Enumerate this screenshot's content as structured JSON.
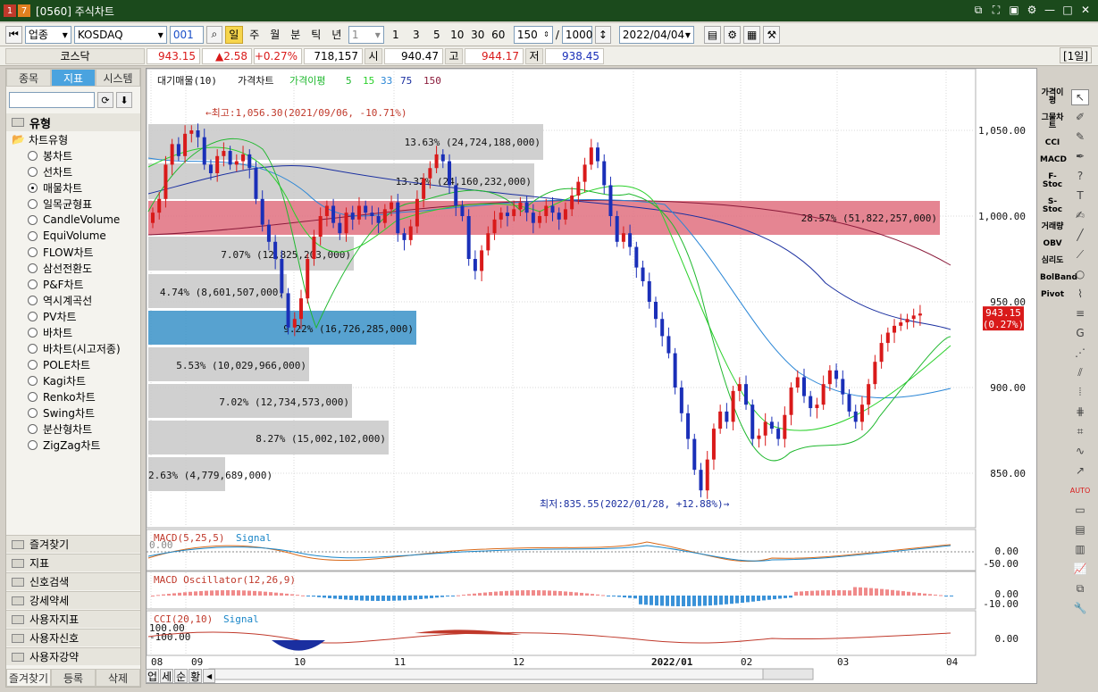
{
  "window": {
    "index_label": "1",
    "index_label2": "7",
    "title": "[0560] 주식차트",
    "controls": [
      "⧉",
      "⛶",
      "▣",
      "⚙",
      "—",
      "□",
      "✕"
    ]
  },
  "toolbar": {
    "market": "업종",
    "index_name": "KOSDAQ",
    "code": "001",
    "periods": [
      "일",
      "주",
      "월",
      "분",
      "틱",
      "년"
    ],
    "interval_value": "1",
    "interval_options": [
      "1",
      "3",
      "5",
      "10",
      "30",
      "60"
    ],
    "count": "150",
    "slash": "/",
    "total": "1000",
    "date": "2022/04/04"
  },
  "quote": {
    "name": "코스닥",
    "price": "943.15",
    "change": "▲2.58",
    "change_pct": "+0.27%",
    "volume": "718,157",
    "open_label": "시",
    "open": "940.47",
    "high_label": "고",
    "high": "944.17",
    "low_label": "저",
    "low": "938.45",
    "period_badge": "[1일]"
  },
  "left_panel": {
    "tabs": [
      "종목",
      "지표",
      "시스템"
    ],
    "active_tab": "지표",
    "section_title": "유형",
    "subsection": "차트유형",
    "chart_types": [
      "봉차트",
      "선차트",
      "매물차트",
      "일목균형표",
      "CandleVolume",
      "EquiVolume",
      "FLOW차트",
      "삼선전환도",
      "P&F차트",
      "역시계곡선",
      "PV차트",
      "바차트",
      "바차트(시고저종)",
      "POLE차트",
      "Kagi차트",
      "Renko차트",
      "Swing차트",
      "분산형차트",
      "ZigZag차트"
    ],
    "selected_type": "매물차트",
    "groups": [
      "즐겨찾기",
      "지표",
      "신호검색",
      "강세약세",
      "사용자지표",
      "사용자신호",
      "사용자강약"
    ],
    "bottom_tabs": [
      "즐겨찾기",
      "등록",
      "삭제"
    ]
  },
  "chart": {
    "legend": {
      "vol_profile": "대기매물(10)",
      "price": "가격차트",
      "ma_label": "가격이평",
      "ma_periods": [
        "5",
        "15",
        "33",
        "75",
        "150"
      ]
    },
    "max_annotation": "←최고:1,056.30(2021/09/06, -10.71%)",
    "min_annotation": "최저:835.55(2022/01/28, +12.88%)→",
    "price_axis": [
      "1,050.00",
      "1,000.00",
      "950.00",
      "900.00",
      "850.00"
    ],
    "current_price_tag": "943.15",
    "current_pct_tag": "(0.27%)",
    "volume_profile_labels": [
      "13.63% (24,724,188,000)",
      "13.32% (24,160,232,000)",
      "28.57% (51,822,257,000)",
      "7.07% (12,825,203,000)",
      "4.74% (8,601,507,000)",
      "9.22% (16,726,285,000)",
      "5.53% (10,029,966,000)",
      "7.02% (12,734,573,000)",
      "8.27% (15,002,102,000)",
      "2.63% (4,779,689,000)"
    ],
    "macd": {
      "title": "MACD(5,25,5)",
      "signal": "Signal",
      "left_tick": "0.00",
      "axis": [
        "0.00",
        "-50.00"
      ]
    },
    "macd_osc": {
      "title": "MACD Oscillator(12,26,9)",
      "axis": [
        "0.00",
        "-10.00"
      ]
    },
    "cci": {
      "title": "CCI(20,10)",
      "signal": "Signal",
      "left_ticks": [
        "100.00",
        "-100.00"
      ],
      "axis": [
        "0.00"
      ]
    },
    "x_axis": [
      "08",
      "09",
      "10",
      "11",
      "12",
      "2022/01",
      "02",
      "03",
      "04"
    ],
    "colors": {
      "up": "#d91a1a",
      "down": "#1a2fb8",
      "ma5": "#1fb82e",
      "ma15": "#2bd12b",
      "ma33": "#2a86d6",
      "ma75": "#1a2fa0",
      "ma150": "#8a1a3a",
      "profile_gray": "#c8c8c8",
      "profile_max": "#e0707f",
      "profile_cur": "#3a92c8"
    }
  },
  "right_tools": {
    "indicators": [
      "가격이평",
      "그물차트",
      "CCI",
      "MACD",
      "F-Stoc",
      "S-Stoc",
      "거래량",
      "OBV",
      "심리도",
      "BolBand",
      "Pivot"
    ]
  },
  "bottom_tabs": [
    "업",
    "세",
    "순",
    "황"
  ]
}
